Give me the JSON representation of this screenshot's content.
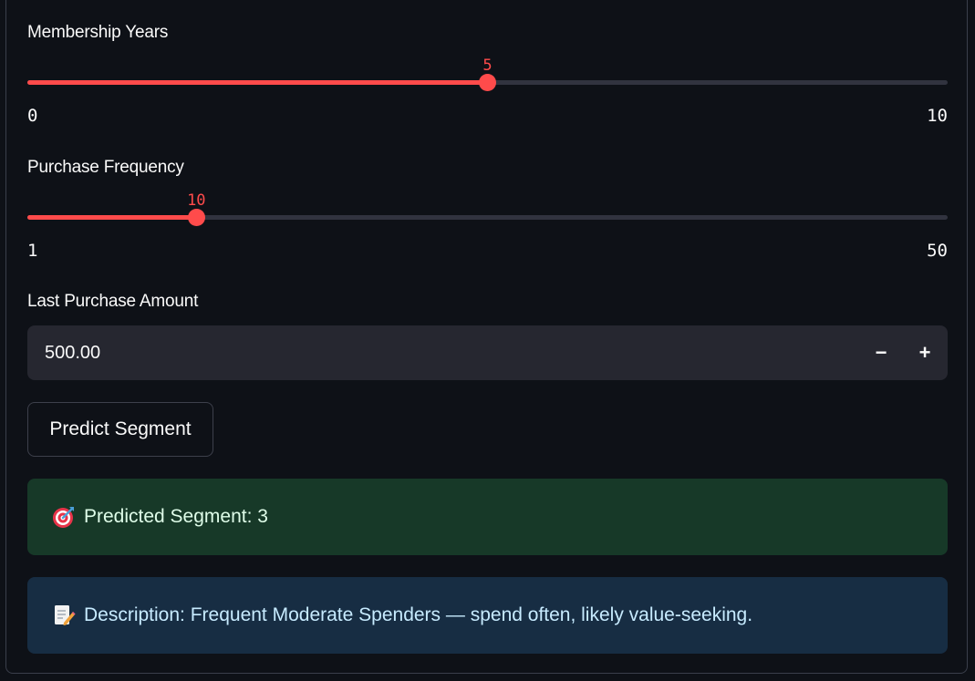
{
  "membership_slider": {
    "label": "Membership Years",
    "value": 5,
    "value_text": "5",
    "min": 0,
    "max": 10,
    "min_text": "0",
    "max_text": "10"
  },
  "frequency_slider": {
    "label": "Purchase Frequency",
    "value": 10,
    "value_text": "10",
    "min": 1,
    "max": 50,
    "min_text": "1",
    "max_text": "50"
  },
  "amount_input": {
    "label": "Last Purchase Amount",
    "value": "500.00",
    "decrement": "−",
    "increment": "+"
  },
  "predict_button": {
    "label": "Predict Segment"
  },
  "result": {
    "icon": "target-icon",
    "text": "Predicted Segment: 3"
  },
  "description": {
    "icon": "memo-icon",
    "text": "Description: Frequent Moderate Spenders — spend often, likely value-seeking."
  },
  "colors": {
    "accent": "#ff4b4b",
    "background": "#0e1117",
    "success_bg": "#173928",
    "info_bg": "#172d43"
  }
}
